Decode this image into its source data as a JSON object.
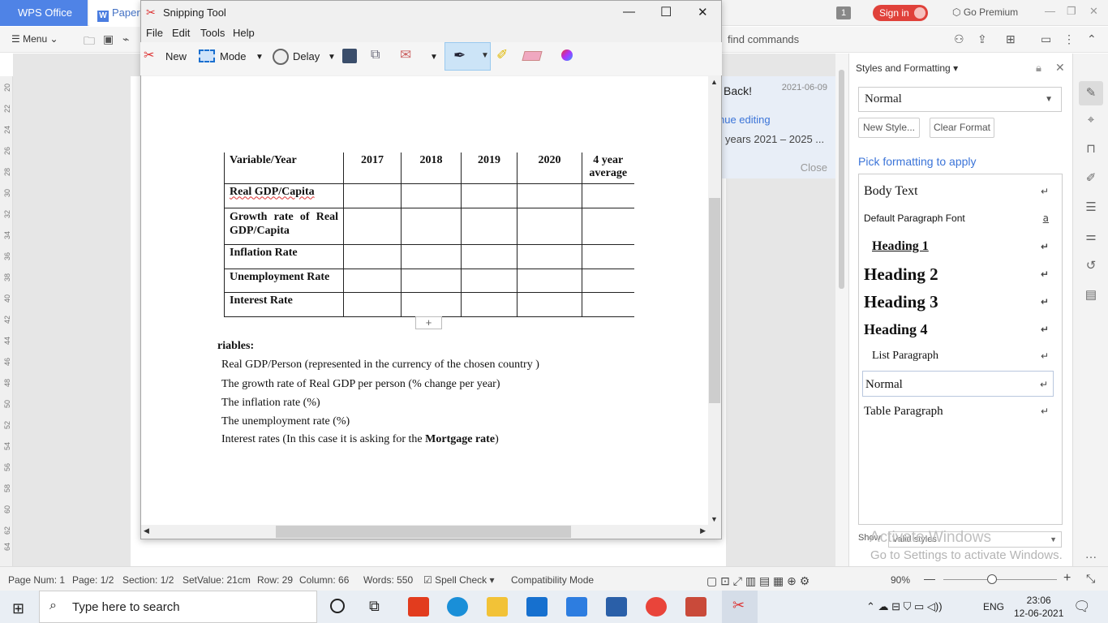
{
  "wps": {
    "home_tab": "WPS Office",
    "doc_tab": "Paper",
    "badge": "1",
    "signin": "Sign in",
    "premium": "Go Premium",
    "menu": "Menu",
    "find": "find commands"
  },
  "snip": {
    "title": "Snipping Tool",
    "menus": [
      "File",
      "Edit",
      "Tools",
      "Help"
    ],
    "new_label": "New",
    "mode_label": "Mode",
    "delay_label": "Delay"
  },
  "doc": {
    "table": {
      "headers": [
        "Variable/Year",
        "2017",
        "2018",
        "2019",
        "2020",
        "4 year average"
      ],
      "rows": [
        "Real GDP/Capita",
        "Growth rate of Real GDP/Capita",
        "Inflation Rate",
        "Unemployment Rate",
        "Interest Rate"
      ]
    },
    "vars_heading": "riables:",
    "lines": [
      "Real GDP/Person (represented in the currency of the chosen country )",
      "The growth rate of Real GDP per person (% change per year)",
      "The inflation rate (%)",
      "The unemployment rate (%)",
      "Interest rates (In this case it is asking for the ",
      "Mortgage rate",
      ")"
    ]
  },
  "notice": {
    "title": "Back!",
    "date": "2021-06-09",
    "link": "nue editing",
    "text": "years 2021 – 2025 ...",
    "close": "Close"
  },
  "styles": {
    "pane_title": "Styles and Formatting",
    "current": "Normal",
    "new_style": "New Style...",
    "clear_format": "Clear Format",
    "pick": "Pick formatting to apply",
    "items": [
      "Body Text",
      "Default Paragraph Font",
      "Heading 1",
      "Heading 2",
      "Heading 3",
      "Heading 4",
      "List Paragraph",
      "Normal",
      "Table Paragraph"
    ],
    "show_label": "Show:",
    "show_value": "Valid styles",
    "activate_title": "Activate Windows",
    "activate_sub": "Go to Settings to activate Windows."
  },
  "ruler_numbers": [
    "20",
    "22",
    "24",
    "26",
    "28",
    "30",
    "32",
    "34",
    "36",
    "38",
    "40",
    "42",
    "44",
    "46",
    "48",
    "50",
    "52",
    "54",
    "56",
    "58",
    "60",
    "62",
    "64"
  ],
  "status": {
    "page_num": "Page Num: 1",
    "page": "Page: 1/2",
    "section": "Section: 1/2",
    "setvalue": "SetValue: 21cm",
    "row": "Row: 29",
    "column": "Column: 66",
    "words": "Words: 550",
    "spell": "Spell Check",
    "compat": "Compatibility Mode",
    "zoom": "90%"
  },
  "taskbar": {
    "search": "Type here to search",
    "lang": "ENG",
    "time": "23:06",
    "date": "12-06-2021"
  }
}
